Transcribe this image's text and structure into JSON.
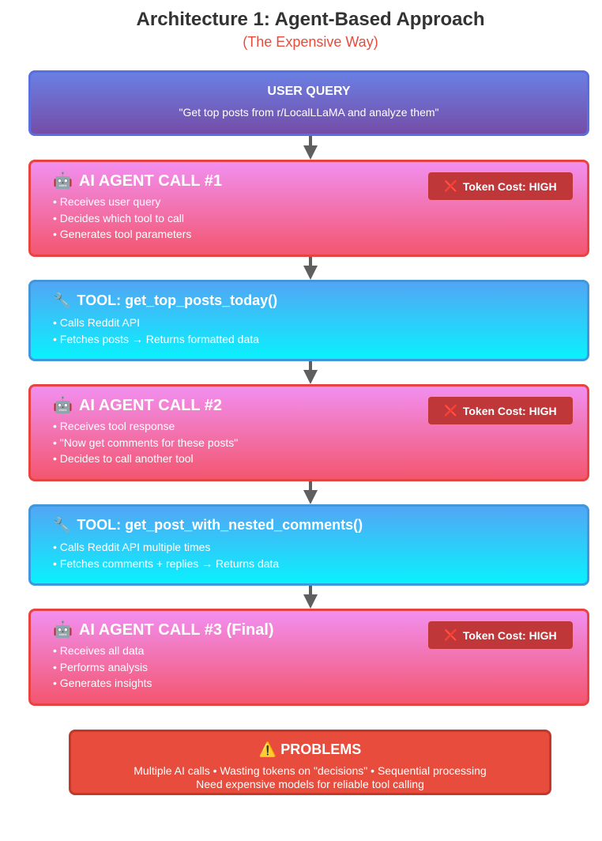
{
  "header": {
    "title": "Architecture 1: Agent-Based Approach",
    "subtitle": "(The Expensive Way)"
  },
  "user_query": {
    "title": "USER QUERY",
    "text": "\"Get top posts from r/LocalLLaMA and analyze them\""
  },
  "steps": [
    {
      "type": "agent",
      "icon": "robot-icon",
      "icon_glyph": "🤖",
      "title": "AI AGENT CALL #1",
      "cost_label": "Token Cost: HIGH",
      "cost_icon": "❌",
      "bullets": [
        "Receives user query",
        "Decides which tool to call",
        "Generates tool parameters"
      ]
    },
    {
      "type": "tool",
      "icon": "wrench-icon",
      "icon_glyph": "🔧",
      "title": "TOOL: get_top_posts_today()",
      "bullets": [
        "Calls Reddit API",
        "Fetches posts → Returns formatted data"
      ]
    },
    {
      "type": "agent",
      "icon": "robot-icon",
      "icon_glyph": "🤖",
      "title": "AI AGENT CALL #2",
      "cost_label": "Token Cost: HIGH",
      "cost_icon": "❌",
      "bullets": [
        "Receives tool response",
        "\"Now get comments for these posts\"",
        "Decides to call another tool"
      ]
    },
    {
      "type": "tool",
      "icon": "wrench-icon",
      "icon_glyph": "🔧",
      "title": "TOOL: get_post_with_nested_comments()",
      "bullets": [
        "Calls Reddit API multiple times",
        "Fetches comments + replies → Returns data"
      ]
    },
    {
      "type": "agent",
      "icon": "robot-icon",
      "icon_glyph": "🤖",
      "title": "AI AGENT CALL #3 (Final)",
      "cost_label": "Token Cost: HIGH",
      "cost_icon": "❌",
      "bullets": [
        "Receives all data",
        "Performs analysis",
        "Generates insights"
      ]
    }
  ],
  "problems": {
    "icon": "warning-icon",
    "icon_glyph": "⚠️",
    "title": "PROBLEMS",
    "line1": "Multiple AI calls • Wasting tokens on \"decisions\" • Sequential processing",
    "line2": "Need expensive models for reliable tool calling"
  },
  "colors": {
    "title_text": "#333333",
    "subtitle_text": "#e74c3c",
    "agent_border": "#e84343",
    "tool_border": "#3f97dd",
    "badge_bg": "#c0373a",
    "problems_bg": "#e74c3c",
    "arrow": "#5f5f5f"
  }
}
